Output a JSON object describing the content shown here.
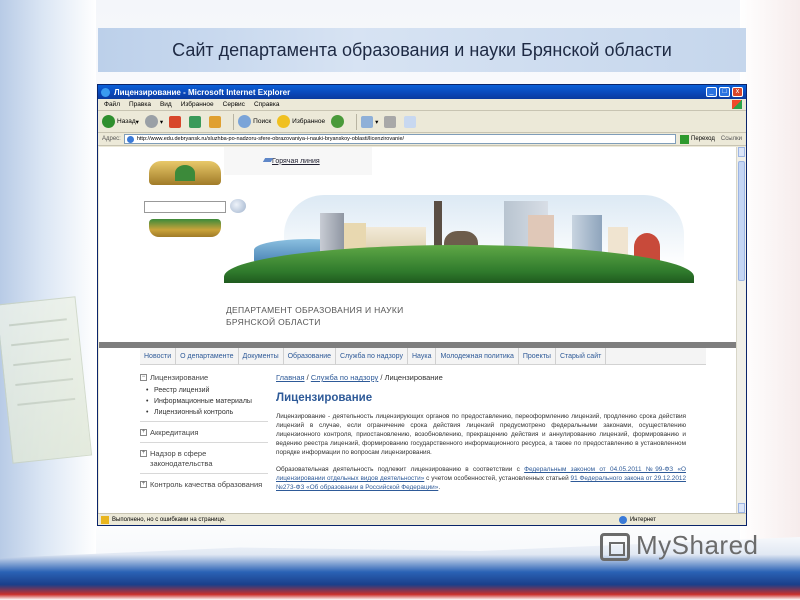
{
  "slide": {
    "title": "Сайт департамента образования и науки Брянской области",
    "watermark": "MyShared"
  },
  "browser": {
    "window_title": "Лицензирование - Microsoft Internet Explorer",
    "menu": [
      "Файл",
      "Правка",
      "Вид",
      "Избранное",
      "Сервис",
      "Справка"
    ],
    "toolbar": {
      "back": "Назад",
      "search": "Поиск",
      "favorites": "Избранное"
    },
    "address": {
      "label": "Адрес:",
      "url": "http://www.edu.debryansk.ru/sluzhba-po-nadzoru-sfere-obrazovaniya-i-nauki-bryanskoy-oblasti/licenzirovanie/",
      "go": "Переход",
      "links": "Ссылки"
    },
    "status": {
      "text": "Выполнено, но с ошибками на странице.",
      "zone": "Интернет"
    }
  },
  "site": {
    "hotline": "Горячая линия",
    "dept_name_line1": "ДЕПАРТАМЕНТ ОБРАЗОВАНИЯ И НАУКИ",
    "dept_name_line2": "БРЯНСКОЙ ОБЛАСТИ",
    "nav": [
      "Новости",
      "О департаменте",
      "Документы",
      "Образование",
      "Служба по надзору",
      "Наука",
      "Молодежная политика",
      "Проекты",
      "Старый сайт"
    ],
    "sidebar": {
      "licensing": "Лицензирование",
      "licensing_subs": [
        "Реестр лицензий",
        "Информационные материалы",
        "Лицензионный контроль"
      ],
      "accreditation": "Аккредитация",
      "supervision": "Надзор в сфере законодательства",
      "quality": "Контроль качества образования"
    },
    "breadcrumb": {
      "home": "Главная",
      "sep": "/",
      "section": "Служба по надзору",
      "current": "Лицензирование"
    },
    "heading": "Лицензирование",
    "paragraph1": "Лицензирование - деятельность лицензирующих органов по предоставлению, переоформлению лицензий, продлению срока действия лицензий в случае, если ограничение срока действия лицензий предусмотрено федеральными законами, осуществлению лицензионного контроля, приостановлению, возобновлению, прекращению действия и аннулированию лицензий, формированию и ведению реестра лицензий, формированию государственного информационного ресурса, а также по предоставлению в установленном порядке информации по вопросам лицензирования.",
    "paragraph2_start": "Образовательная деятельность подлежит лицензированию в соответствии с ",
    "paragraph2_link1": "Федеральным законом от 04.05.2011 №99-ФЗ «О лицензировании отдельных видов деятельности»",
    "paragraph2_mid": " с учетом особенностей, установленных статьей ",
    "paragraph2_link2": "91 Федерального закона от 29.12.2012 №273-ФЗ «Об образовании в Российской Федерации»",
    "paragraph2_end": "."
  }
}
